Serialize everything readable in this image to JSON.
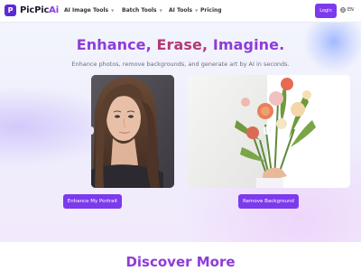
{
  "header": {
    "logo_mark": "P",
    "brand_main": "PicPic",
    "brand_accent": "Ai",
    "nav": [
      {
        "label": "AI Image Tools",
        "has_dropdown": true
      },
      {
        "label": "Batch Tools",
        "has_dropdown": true
      },
      {
        "label": "AI Tools",
        "has_dropdown": true
      },
      {
        "label": "Pricing",
        "has_dropdown": false
      }
    ],
    "login_label": "Login",
    "language": "EN",
    "language_icon": "globe-icon",
    "dropdown_icon": "chevron-down-icon"
  },
  "hero": {
    "headline_1": "Enhance,",
    "headline_2": "Erase,",
    "headline_3": "Imagine.",
    "subtitle": "Enhance photos, remove backgrounds, and generate art by AI in seconds."
  },
  "panels": {
    "handle_icon": "drag-handle-icon",
    "portrait_button": "Enhance My Portrait",
    "background_button": "Remove Background"
  },
  "section": {
    "title": "Discover More"
  },
  "colors": {
    "accent": "#7c3aed",
    "headline_purple": "#8e3cd8",
    "headline_magenta": "#b33a72"
  }
}
